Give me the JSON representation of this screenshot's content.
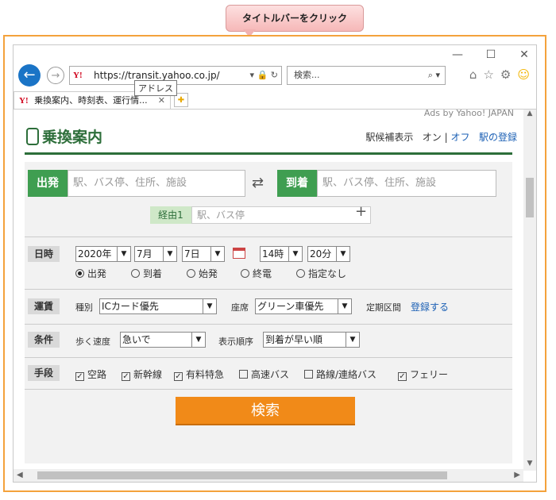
{
  "callout": {
    "text": "タイトルバーをクリック"
  },
  "window": {
    "minimize": "—",
    "maximize": "☐",
    "close": "✕"
  },
  "browser": {
    "url": "https://transit.yahoo.co.jp/",
    "tooltip": "アドレス",
    "search_placeholder": "検索...",
    "tab_title": "乗換案内、時刻表、運行情..."
  },
  "page": {
    "ads": "Ads by Yahoo! JAPAN",
    "brand": "乗換案内",
    "station_hint_label": "駅候補表示",
    "on": "オン",
    "separator": "|",
    "off": "オフ",
    "register_station": "駅の登録"
  },
  "route": {
    "from_label": "出発",
    "from_placeholder": "駅、バス停、住所、施設",
    "to_label": "到着",
    "to_placeholder": "駅、バス停、住所、施設",
    "via_label": "経由1",
    "via_placeholder": "駅、バス停"
  },
  "datetime": {
    "label": "日時",
    "year": "2020年",
    "month": "7月",
    "day": "7日",
    "hour": "14時",
    "minute": "20分",
    "options": [
      "出発",
      "到着",
      "始発",
      "終電",
      "指定なし"
    ],
    "selected": "出発"
  },
  "fare": {
    "label": "運賃",
    "type_label": "種別",
    "type_value": "ICカード優先",
    "seat_label": "座席",
    "seat_value": "グリーン車優先",
    "pass_label": "定期区間",
    "pass_link": "登録する"
  },
  "conditions": {
    "label": "条件",
    "speed_label": "歩く速度",
    "speed_value": "急いで",
    "order_label": "表示順序",
    "order_value": "到着が早い順"
  },
  "means": {
    "label": "手段",
    "items": [
      {
        "label": "空路",
        "checked": true
      },
      {
        "label": "新幹線",
        "checked": true
      },
      {
        "label": "有料特急",
        "checked": true
      },
      {
        "label": "高速バス",
        "checked": false
      },
      {
        "label": "路線/連絡バス",
        "checked": false
      },
      {
        "label": "フェリー",
        "checked": true
      }
    ]
  },
  "search_button": "検索",
  "colors": {
    "brand_green": "#2d6e3a",
    "accent_orange": "#f18a18",
    "link_blue": "#1a5fb4"
  }
}
